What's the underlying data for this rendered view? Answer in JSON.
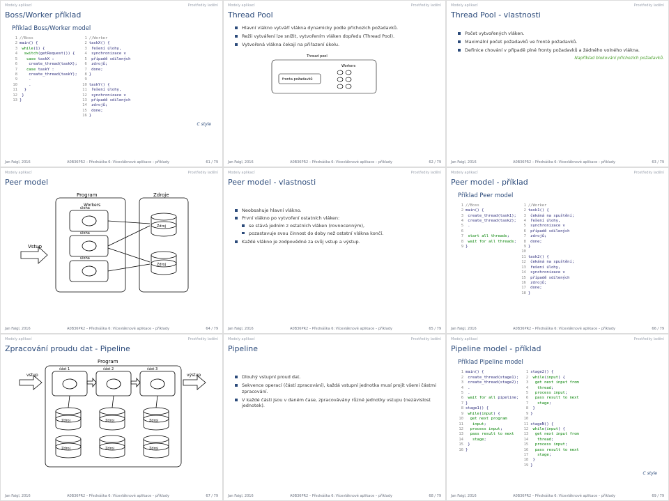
{
  "tabs": {
    "left": "Modely aplikací",
    "right": "Prostředky ladění"
  },
  "footer": {
    "author": "Jan Faigl, 2016",
    "mid": "A0B36PR2 – Přednáška 6: Vícevláknové aplikace – příklady"
  },
  "s1": {
    "title": "Boss/Worker příklad",
    "subtitle": "Příklad Boss/Worker model",
    "codeL": [
      "//Boss",
      "main() {",
      " while(1) {",
      "  switch(getRequest()) {",
      "   case taskX :",
      "    create_thread(taskX);",
      "   case taskY :",
      "    create_thread(taskY);",
      "    .",
      "    .",
      "  }",
      " }",
      "}"
    ],
    "codeR": [
      "//Worker",
      "taskX() {",
      " řešení úlohy,",
      " synchronizace v",
      " případě sdílených",
      " zdrojů;",
      " done;",
      "}",
      "",
      "taskY() {",
      " řešení úlohy,",
      " synchronizace v",
      " případě sdílených",
      " zdrojů;",
      " done;",
      "}"
    ],
    "cstyle": "C style",
    "page": "61 / 79"
  },
  "s2": {
    "title": "Thread Pool",
    "b1": "Hlavní vlákno vytváří vlákna dynamicky podle příchozích požadavků.",
    "b2": "Režii vytváření lze snížit, vytvořením vláken dopředu (Thread Pool).",
    "b3": "Vytvořená vlákna čekají na přiřazení úkolu.",
    "poolLabel": "Thread pool",
    "queueLabel": "fronta požadavků",
    "workersLabel": "Workers",
    "page": "62 / 79"
  },
  "s3": {
    "title": "Thread Pool - vlastnosti",
    "b1": "Počet vytvořených vláken.",
    "b2": "Maximální počet požadavků ve frontě požadavků.",
    "b3": "Definice chování v případě plné fronty požadavků a žádného volného vlákna.",
    "note": "Například blokování příchozích požadavků.",
    "page": "63 / 79"
  },
  "s4": {
    "title": "Peer model",
    "vstup": "Vstup",
    "program": "Program",
    "zdroje": "Zdroje",
    "workers": "Workers",
    "uloha": "úloha",
    "zdroj": "Zdroj",
    "page": "64 / 79"
  },
  "s5": {
    "title": "Peer model - vlastnosti",
    "b1": "Neobsahuje hlavní vlákno.",
    "b2": "První vlákno po vytvoření ostatních vláken:",
    "b2a": "se stává jedním z ostatních vláken (rovnocenným),",
    "b2b": "pozastavuje svou činnost do doby než ostatní vlákna končí.",
    "b3": "Každé vlákno je zodpovědné za svůj vstup a výstup.",
    "page": "65 / 79"
  },
  "s6": {
    "title": "Peer model - příklad",
    "subtitle": "Příklad Peer model",
    "codeL": [
      "//Boss",
      "main() {",
      " create_thread(task1);",
      " create_thread(task2);",
      " .",
      "",
      " start all threads;",
      " wait for all threads;",
      "}"
    ],
    "codeR": [
      "//Worker",
      "task1() {",
      " čekáná na spuštění;",
      " řešení úlohy,",
      " synchronizace v",
      " případě sdílených",
      " zdrojů;",
      " done;",
      "}",
      "",
      "task2() {",
      " čekáná na spuštění;",
      " řešení úlohy,",
      " synchronizace v",
      " případě sdílených",
      " zdrojů;",
      " done;",
      "}"
    ],
    "page": "66 / 79"
  },
  "s7": {
    "title": "Zpracování proudu dat - Pipeline",
    "program": "Program",
    "vstup": "vstup",
    "vystup": "výstup",
    "cast1": "část 1",
    "cast2": "část 2",
    "cast3": "část 3",
    "zdroj": "Zdroj",
    "page": "67 / 79"
  },
  "s8": {
    "title": "Pipeline",
    "b1": "Dlouhý vstupní proud dat.",
    "b2": "Sekvence operací (částí zpracování), každá vstupní jednotka musí projít všemi částmi zpracování.",
    "b3": "V každé části jsou v daném čase, zpracovávány různé jednotky vstupu (nezávislost jednotek).",
    "page": "68 / 79"
  },
  "s9": {
    "title": "Pipeline model - příklad",
    "subtitle": "Příklad Pipeline model",
    "codeL": [
      "main() {",
      " create_thread(stage1);",
      " create_thread(stage2);",
      " .",
      " .",
      " wait for all pipeline;",
      "}",
      "stage1() {",
      " while(input) {",
      "  get next program",
      "   input;",
      "  process input;",
      "  pass result to next",
      "   stage;",
      " }",
      "}"
    ],
    "codeR": [
      "stage2() {",
      " while(input) {",
      "  get next input from",
      "   thread;",
      "  process input;",
      "  pass result to next",
      "   stage;",
      " }",
      "}",
      "",
      "stageN() {",
      " while(input) {",
      "  get next input from",
      "   thread;",
      "  process input;",
      "  pass result to next",
      "   stage;",
      " }",
      "}"
    ],
    "cstyle": "C style",
    "page": "69 / 79"
  }
}
